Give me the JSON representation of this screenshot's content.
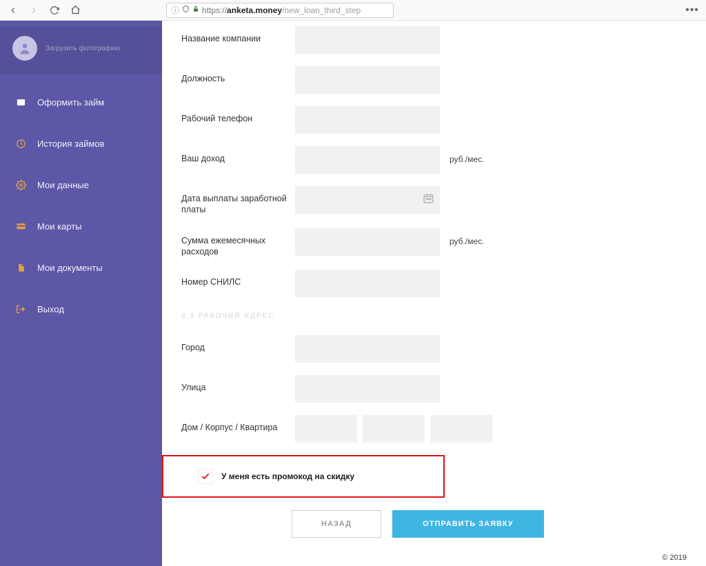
{
  "browser": {
    "url_prefix": "https://",
    "url_host": "anketa.money",
    "url_path": "/new_loan_third_step"
  },
  "profile": {
    "upload_text": "Загрузить фотографию"
  },
  "sidebar": {
    "items": [
      {
        "label": "Оформить займ"
      },
      {
        "label": "История займов"
      },
      {
        "label": "Мои данные"
      },
      {
        "label": "Мои карты"
      },
      {
        "label": "Мои документы"
      },
      {
        "label": "Выход"
      }
    ]
  },
  "form": {
    "company_label": "Название компании",
    "position_label": "Должность",
    "work_phone_label": "Рабочий телефон",
    "income_label": "Ваш доход",
    "income_suffix": "руб./мес.",
    "payday_label": "Дата выплаты заработной платы",
    "expenses_label": "Сумма ежемесячных расходов",
    "expenses_suffix": "руб./мес.",
    "snils_label": "Номер СНИЛС",
    "section_address": "3.3 РАБОЧИЙ АДРЕС",
    "city_label": "Город",
    "street_label": "Улица",
    "house_label": "Дом / Корпус / Квартира"
  },
  "promo": {
    "label": "У меня есть промокод на скидку"
  },
  "buttons": {
    "back": "НАЗАД",
    "submit": "ОТПРАВИТЬ ЗАЯВКУ"
  },
  "footer": {
    "copyright": "© 2019"
  }
}
